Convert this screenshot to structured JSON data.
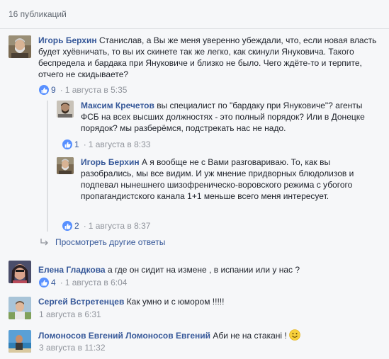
{
  "header": {
    "count_label": "16 публикаций"
  },
  "comments": [
    {
      "author": "Игорь Берхин",
      "text": "Станислав, а Вы же меня уверенно убеждали, что, если новая власть будет хуёвничать, то вы их скинете так же легко, как скинули Януковича. Такого беспредела и бардака при Януковиче и близко не было. Чего ждёте-то и терпите, отчего не скидываете?",
      "likes": "9",
      "date": "1 августа в 5:35"
    },
    {
      "author": "Максим Кречетов",
      "text": "вы специалист по \"бардаку при Януковиче\"? агенты ФСБ на всех высших должностях - это полный порядок? Или в Донецке порядок? мы разберёмся, подстрекать нас не надо.",
      "likes": "1",
      "date": "1 августа в 8:33"
    },
    {
      "author": "Игорь Берхин",
      "text": "А я вообще не с Вами разговариваю. То, как вы разобрались, мы все видим. И уж мнение придворных блюдолизов и подпевал нынешнего шизофреническо-воровского режима с убогого пропагандистского канала 1+1 меньше всего меня интересует.",
      "likes": "2",
      "date": "1 августа в 8:37"
    },
    {
      "author": "Елена Гладкова",
      "text": "а где он сидит на измене , в испании или у нас ?",
      "likes": "4",
      "date": "1 августа в 6:04"
    },
    {
      "author": "Сергей Встретенцев",
      "text": "Как умно и с юмором !!!!!",
      "date": "1 августа в 6:31"
    },
    {
      "author": "Ломоносов Евгений Ломоносов Евгений",
      "text": "Аби не на стакані !",
      "date": "3 августа в 11:32"
    }
  ],
  "more_replies_label": "Просмотреть другие ответы",
  "colors": {
    "link": "#365899",
    "like": "#5890ff",
    "meta": "#90949c",
    "bg": "#f6f7f9"
  },
  "icons": [
    "thumbs-up-icon",
    "reply-arrow-icon",
    "smiley-icon"
  ]
}
